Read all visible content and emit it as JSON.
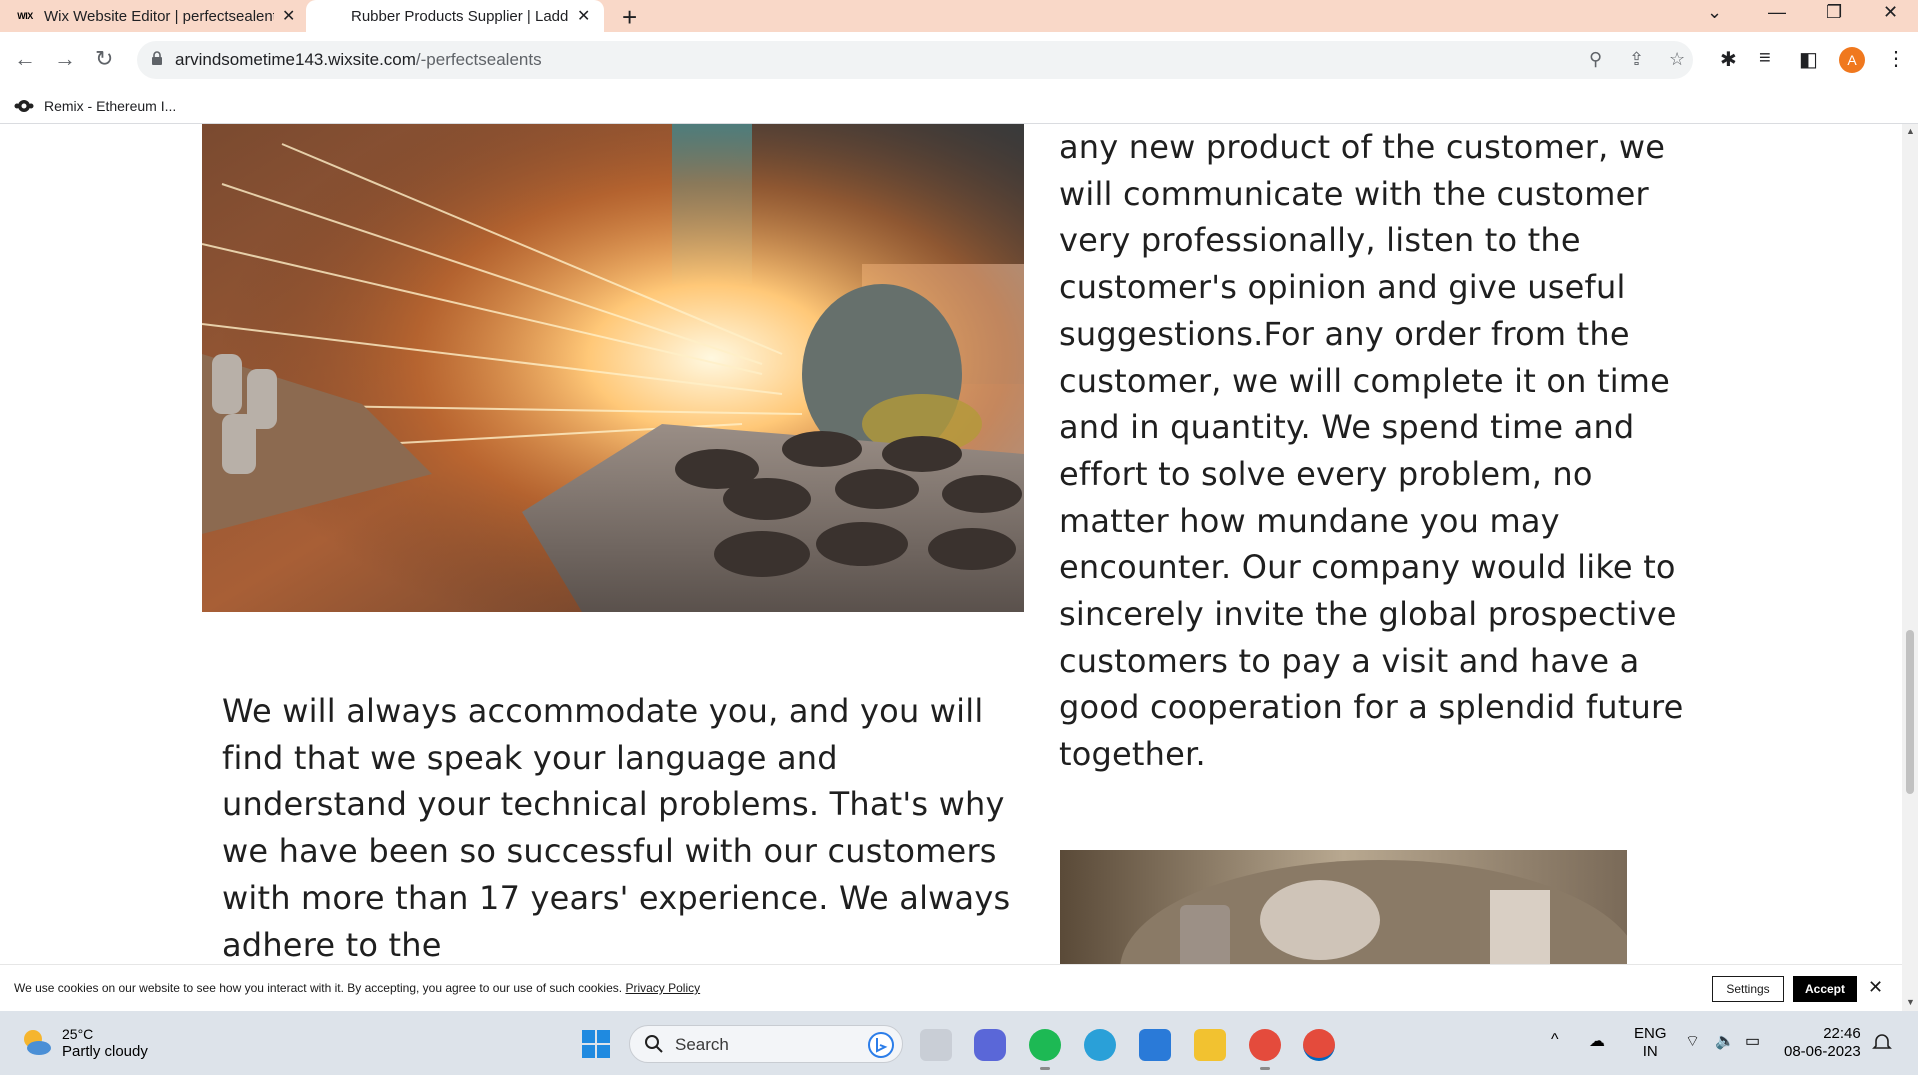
{
  "browser": {
    "tabs": [
      {
        "favicon_text": "WIX",
        "title": "Wix Website Editor | perfectsealents"
      },
      {
        "title": "Rubber Products Supplier | Ladder"
      }
    ],
    "address": {
      "domain": "arvindsometime143.wixsite.com",
      "path": "/-perfectsealents"
    },
    "bookmark": {
      "label": "Remix - Ethereum I..."
    },
    "profile_initial": "A"
  },
  "page": {
    "right_paragraph": "any new product of the customer, we will communicate with the customer very professionally, listen to the customer's opinion and give useful suggestions.For any order from the customer, we will complete it on time and in quantity. We spend time and effort to solve every problem, no matter how mundane you may encounter. Our company would like to sincerely invite the global prospective customers to pay a visit and have a good cooperation for a splendid future together.",
    "left_paragraph": "We will always accommodate you, and you will find that we speak your language and understand your technical problems. That's why we have been so successful with our customers with more than 17 years' experience. We always adhere to the"
  },
  "cookie_banner": {
    "text": "We use cookies on our website to see how you interact with it. By accepting, you agree to our use of such cookies.",
    "link": "Privacy Policy",
    "settings_label": "Settings",
    "accept_label": "Accept"
  },
  "taskbar": {
    "weather_temp": "25°C",
    "weather_desc": "Partly cloudy",
    "search_label": "Search",
    "language": "ENG",
    "region": "IN",
    "time": "22:46",
    "date": "08-06-2023"
  }
}
